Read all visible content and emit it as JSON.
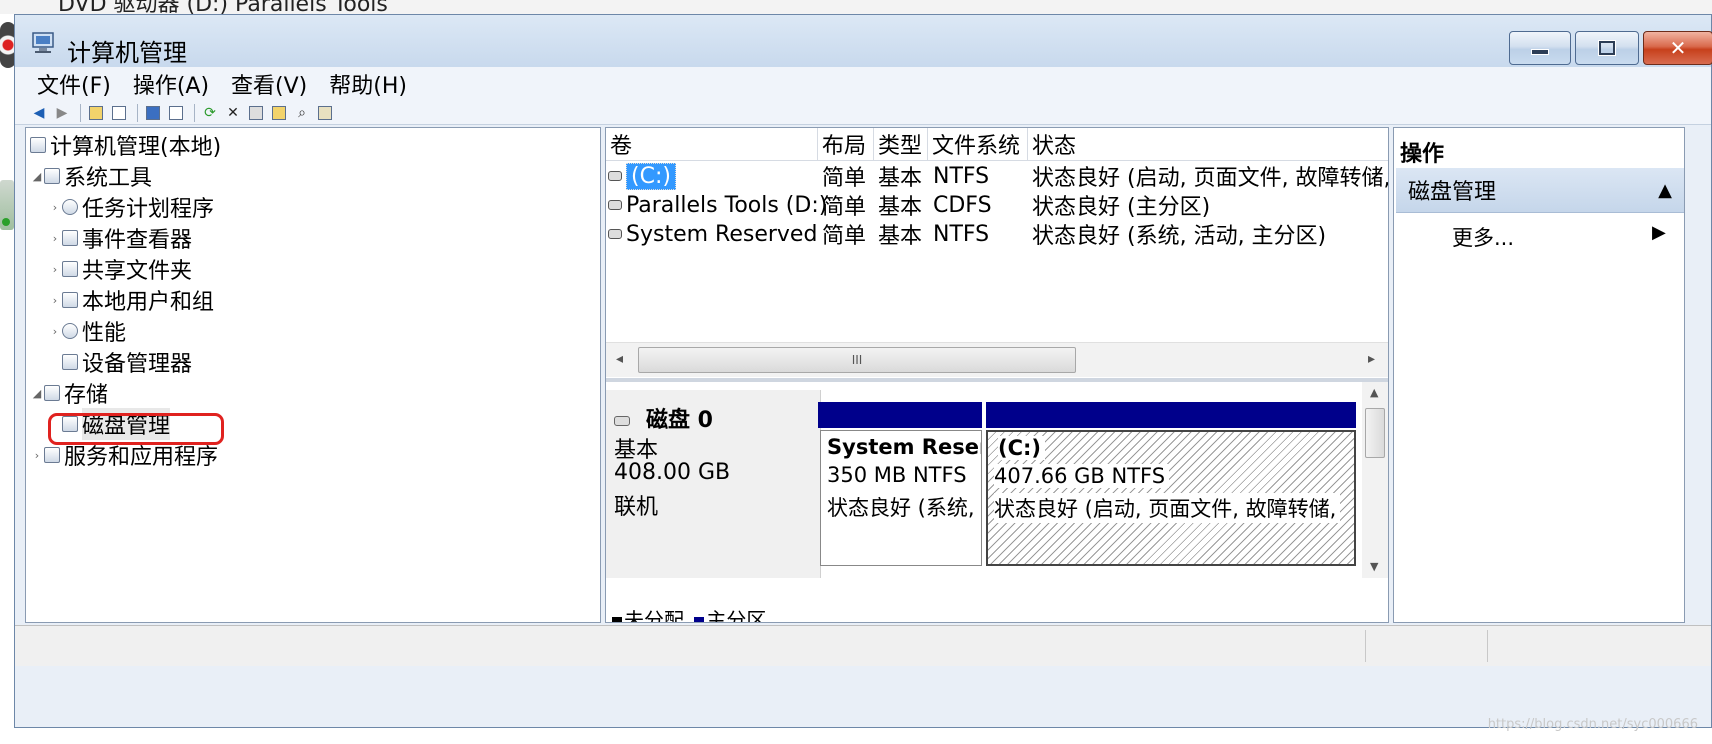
{
  "background": {
    "partial_text": "DVD 驱动器 (D:) Parallels Tools"
  },
  "window": {
    "title": "计算机管理",
    "icon": "computer-management-icon",
    "minimize": "minimize-button",
    "maximize": "maximize-button",
    "close_symbol": "✕"
  },
  "menu": {
    "file": "文件(F)",
    "action": "操作(A)",
    "view": "查看(V)",
    "help": "帮助(H)"
  },
  "toolbar": {
    "icons": [
      "back-arrow-icon",
      "forward-arrow-icon",
      "up-folder-icon",
      "show-hide-tree-icon",
      "help-icon",
      "show-hide-action-pane-icon",
      "refresh-icon",
      "delete-icon",
      "properties-icon",
      "open-icon",
      "search-icon",
      "export-list-icon"
    ]
  },
  "tree": {
    "root": "计算机管理(本地)",
    "system_tools": "系统工具",
    "task_scheduler": "任务计划程序",
    "event_viewer": "事件查看器",
    "shared_folders": "共享文件夹",
    "local_users": "本地用户和组",
    "performance": "性能",
    "device_manager": "设备管理器",
    "storage": "存储",
    "disk_management": "磁盘管理",
    "services_apps": "服务和应用程序"
  },
  "volume_table": {
    "headers": [
      "卷",
      "布局",
      "类型",
      "文件系统",
      "状态"
    ],
    "rows": [
      {
        "volume": "(C:)",
        "layout": "简单",
        "type": "基本",
        "fs": "NTFS",
        "status": "状态良好 (启动, 页面文件, 故障转储,"
      },
      {
        "volume": "Parallels Tools (D:)",
        "layout": "简单",
        "type": "基本",
        "fs": "CDFS",
        "status": "状态良好 (主分区)"
      },
      {
        "volume": "System Reserved",
        "layout": "简单",
        "type": "基本",
        "fs": "NTFS",
        "status": "状态良好 (系统, 活动, 主分区)"
      }
    ],
    "scroll_thumb": "III"
  },
  "disk": {
    "name": "磁盘 0",
    "type": "基本",
    "size": "408.00 GB",
    "state": "联机",
    "partitions": [
      {
        "name": "System Reserv",
        "size": "350 MB NTFS",
        "status": "状态良好 (系统,"
      },
      {
        "name": "(C:)",
        "size": "407.66 GB NTFS",
        "status": "状态良好 (启动, 页面文件, 故障转储,"
      }
    ],
    "partition_color": "#00008b"
  },
  "legend": {
    "unallocated": "未分配",
    "primary": "主分区",
    "unallocated_color": "#000000",
    "primary_color": "#00008b"
  },
  "actions": {
    "title": "操作",
    "section": "磁盘管理",
    "more": "更多..."
  },
  "watermark": "https://blog.csdn.net/syc000666"
}
